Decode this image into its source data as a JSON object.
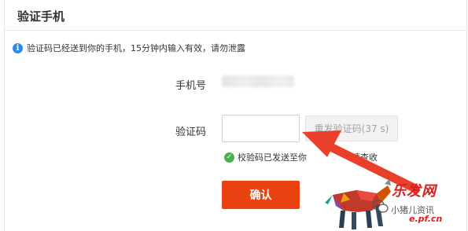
{
  "header": {
    "title": "验证手机"
  },
  "notice": {
    "icon": "info-icon",
    "text": "验证码已经送到你的手机，15分钟内输入有效，请勿泄露"
  },
  "form": {
    "phone_label": "手机号",
    "code_label": "验证码",
    "code_value": "",
    "resend_label": "重发验证码(37 s)",
    "sent_icon": "check-circle-icon",
    "sent_text": "校验码已发送至你",
    "sent_tail": "请查收",
    "confirm_label": "确认"
  },
  "watermark": {
    "brand": "乐发网",
    "sub": "小猪儿资讯",
    "url": "e.pf.cn"
  },
  "colors": {
    "accent": "#e84310",
    "info": "#2a8ce5",
    "success": "#4caf50",
    "arrow": "#e8402a"
  }
}
